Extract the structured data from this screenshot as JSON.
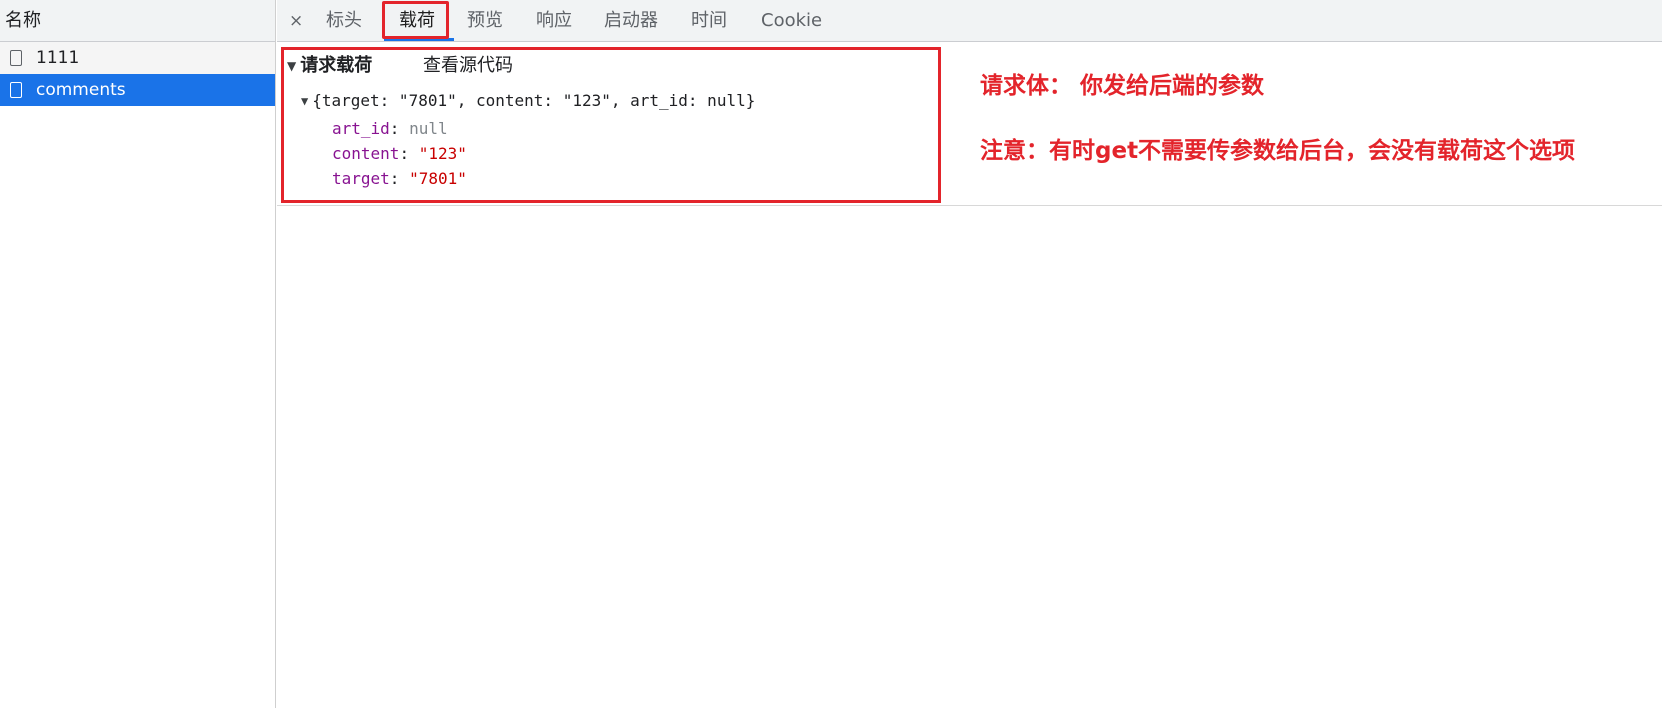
{
  "request_list": {
    "header": "名称",
    "items": [
      {
        "name": "1111"
      },
      {
        "name": "comments"
      }
    ]
  },
  "tabs": {
    "close_symbol": "×",
    "items": [
      "标头",
      "载荷",
      "预览",
      "响应",
      "启动器",
      "时间",
      "Cookie"
    ],
    "active": "载荷"
  },
  "payload": {
    "section_title": "请求载荷",
    "view_source_label": "查看源代码",
    "summary": "{target: \"7801\", content: \"123\", art_id: null}",
    "properties": [
      {
        "key": "art_id",
        "value": "null",
        "type": "null"
      },
      {
        "key": "content",
        "value": "\"123\"",
        "type": "string"
      },
      {
        "key": "target",
        "value": "\"7801\"",
        "type": "string"
      }
    ]
  },
  "annotations": {
    "line1": "请求体：  你发给后端的参数",
    "line2": "注意：有时get不需要传参数给后台，会没有载荷这个选项"
  },
  "colors": {
    "selection": "#1a73e8",
    "highlight_red": "#e3242b",
    "key_purple": "#881391",
    "string_red": "#c80000"
  }
}
